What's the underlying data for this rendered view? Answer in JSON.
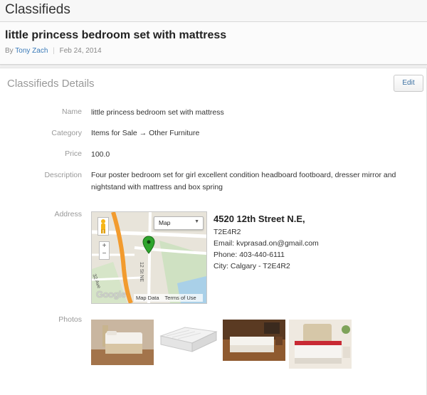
{
  "app": {
    "title": "Classifieds"
  },
  "listing": {
    "title": "little princess bedroom set with mattress",
    "by_prefix": "By",
    "author": "Tony Zach",
    "date": "Feb 24, 2014"
  },
  "details": {
    "section_title": "Classifieds Details",
    "edit_label": "Edit",
    "fields": {
      "name": {
        "label": "Name",
        "value": "little princess bedroom set with mattress"
      },
      "category": {
        "label": "Category",
        "value": "Items for Sale → Other Furniture"
      },
      "price": {
        "label": "Price",
        "value": "100.0"
      },
      "description": {
        "label": "Description",
        "value": "Four poster bedroom set for girl excellent condition headboard footboard, dresser mirror and nightstand with mattress and box spring"
      },
      "address": {
        "label": "Address"
      },
      "photos": {
        "label": "Photos"
      }
    },
    "address": {
      "street": "4520 12th Street N.E,",
      "postal": "T2E4R2",
      "email": "Email: kvprasad.on@gmail.com",
      "phone": "Phone: 403-440-6111",
      "city": "City: Calgary - T2E4R2"
    },
    "map": {
      "type_select": "Map",
      "zoom_in": "+",
      "zoom_out": "−",
      "street_label": "12 St NE",
      "street_label_2": "32 Ave",
      "logo": "Google",
      "map_data": "Map Data",
      "terms": "Terms of Use"
    },
    "photos": [
      {
        "name": "photo-bedroom-set"
      },
      {
        "name": "photo-mattress"
      },
      {
        "name": "photo-bed-room"
      },
      {
        "name": "photo-bed-headboard"
      }
    ]
  }
}
